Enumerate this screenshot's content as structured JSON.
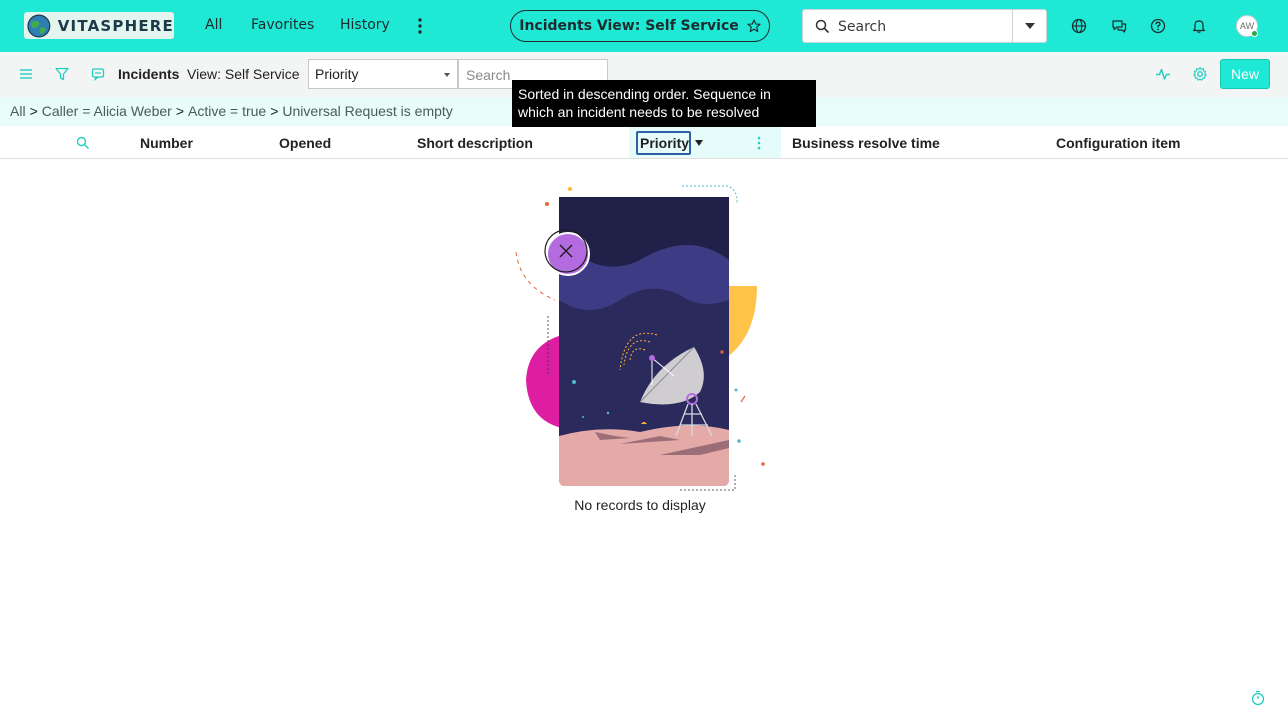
{
  "header": {
    "brand": "VITASPHERE",
    "nav": [
      {
        "label": "All"
      },
      {
        "label": "Favorites"
      },
      {
        "label": "History"
      }
    ],
    "title_pill": "Incidents View: Self Service",
    "search_placeholder": "Search",
    "avatar_initials": "AW",
    "icons": [
      "globe-icon",
      "chat-icon",
      "help-icon",
      "bell-icon"
    ]
  },
  "listbar": {
    "title": "Incidents",
    "view": "View: Self Service",
    "field_select_value": "Priority",
    "search_placeholder": "Search",
    "new_label": "New"
  },
  "tooltip": {
    "text": "Sorted in descending order. Sequence in which an incident needs to be resolved"
  },
  "breadcrumbs": [
    {
      "label": "All"
    },
    {
      "label": "Caller = Alicia Weber"
    },
    {
      "label": "Active = true"
    },
    {
      "label": "Universal Request is empty"
    }
  ],
  "breadcrumb_separator": ">",
  "columns": [
    {
      "label": "Number"
    },
    {
      "label": "Opened"
    },
    {
      "label": "Short description"
    },
    {
      "label": "Priority",
      "sorted": "descending"
    },
    {
      "label": "Business resolve time"
    },
    {
      "label": "Configuration item"
    }
  ],
  "empty_state": {
    "message": "No records to display"
  },
  "colors": {
    "accent": "#1fe9d5",
    "breadcrumb_bg": "#e8fcfa",
    "tooltip_bg": "#000000"
  }
}
